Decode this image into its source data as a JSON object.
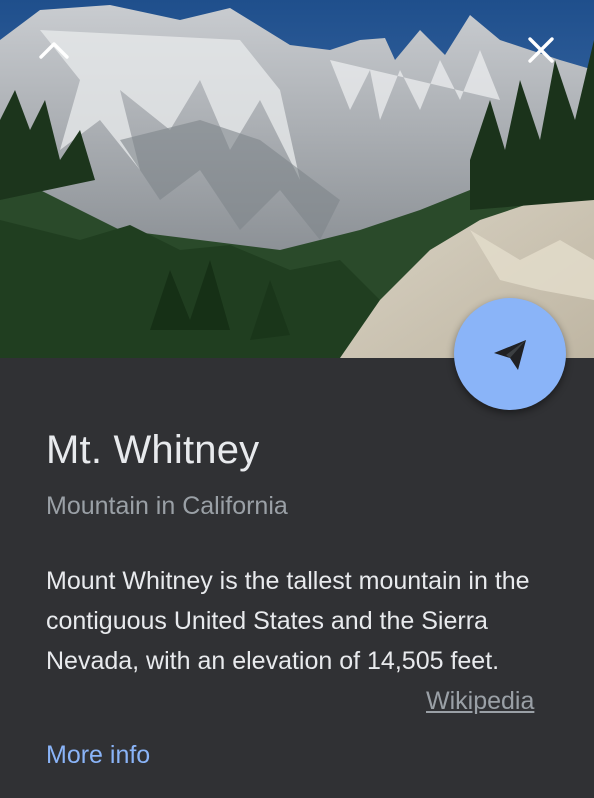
{
  "place": {
    "title": "Mt. Whitney",
    "subtitle": "Mountain in California",
    "description": "Mount Whitney is the tallest mountain in the contiguous United States and the Sierra Nevada, with an elevation of 14,505 feet."
  },
  "links": {
    "source_label": "Wikipedia",
    "more_info_label": "More info"
  },
  "icons": {
    "collapse": "chevron-up-icon",
    "close": "close-icon",
    "send": "paper-plane-icon"
  },
  "colors": {
    "background": "#303134",
    "title": "#e8eaed",
    "secondary_text": "#9aa0a6",
    "accent": "#8ab4f8"
  }
}
